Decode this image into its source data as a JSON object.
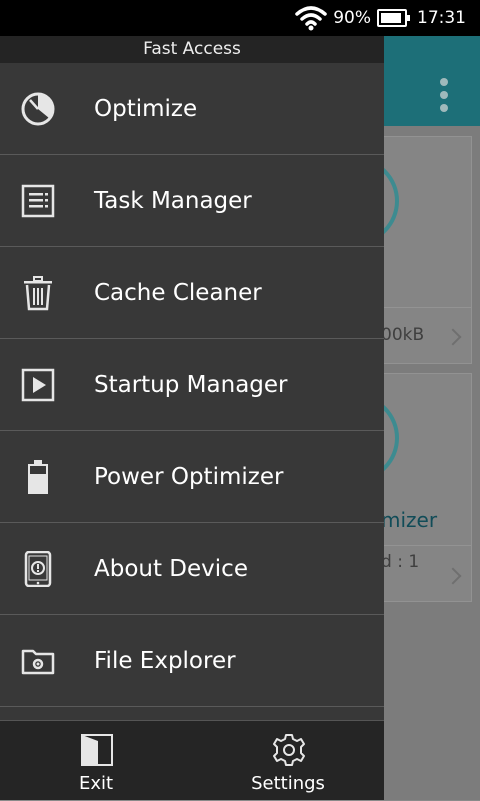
{
  "status_bar": {
    "battery_percent": "90%",
    "time": "17:31",
    "battery_fill": 0.9
  },
  "background": {
    "card1_value": "00kB",
    "card2_title": "mizer",
    "card2_value": "d : 1"
  },
  "drawer": {
    "title": "Fast Access",
    "items": [
      {
        "label": "Optimize",
        "icon": "clock-icon"
      },
      {
        "label": "Task Manager",
        "icon": "task-list-icon"
      },
      {
        "label": "Cache Cleaner",
        "icon": "trash-icon"
      },
      {
        "label": "Startup Manager",
        "icon": "play-icon"
      },
      {
        "label": "Power Optimizer",
        "icon": "battery-icon"
      },
      {
        "label": "About Device",
        "icon": "phone-info-icon"
      },
      {
        "label": "File Explorer",
        "icon": "folder-gear-icon"
      }
    ],
    "bottom": {
      "exit": {
        "label": "Exit",
        "icon": "exit-door-icon"
      },
      "settings": {
        "label": "Settings",
        "icon": "gear-icon"
      }
    }
  },
  "colors": {
    "drawer_bg": "#383838",
    "accent": "#1d6f78"
  }
}
